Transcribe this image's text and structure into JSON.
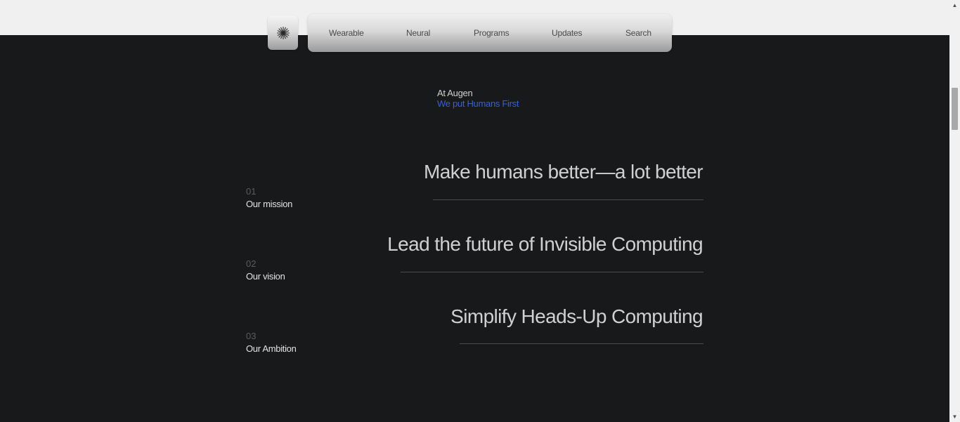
{
  "nav": {
    "items": [
      {
        "label": "Wearable"
      },
      {
        "label": "Neural"
      },
      {
        "label": "Programs"
      },
      {
        "label": "Updates"
      },
      {
        "label": "Search"
      }
    ],
    "logo_icon": "asterisk-burst-icon"
  },
  "intro": {
    "label": "At Augen",
    "tagline": "We put Humans First"
  },
  "rows": [
    {
      "number": "01",
      "label": "Our mission",
      "statement": "Make humans better—a lot better"
    },
    {
      "number": "02",
      "label": "Our vision",
      "statement": "Lead the future of Invisible Computing"
    },
    {
      "number": "03",
      "label": "Our Ambition",
      "statement": "Simplify Heads-Up Computing"
    }
  ],
  "colors": {
    "background_dark": "#18191b",
    "accent_blue": "#3a5fd9",
    "page_light": "#f0f0f0"
  },
  "scrollbar": {
    "up_icon": "scroll-up-arrow-icon",
    "down_icon": "scroll-down-arrow-icon"
  }
}
